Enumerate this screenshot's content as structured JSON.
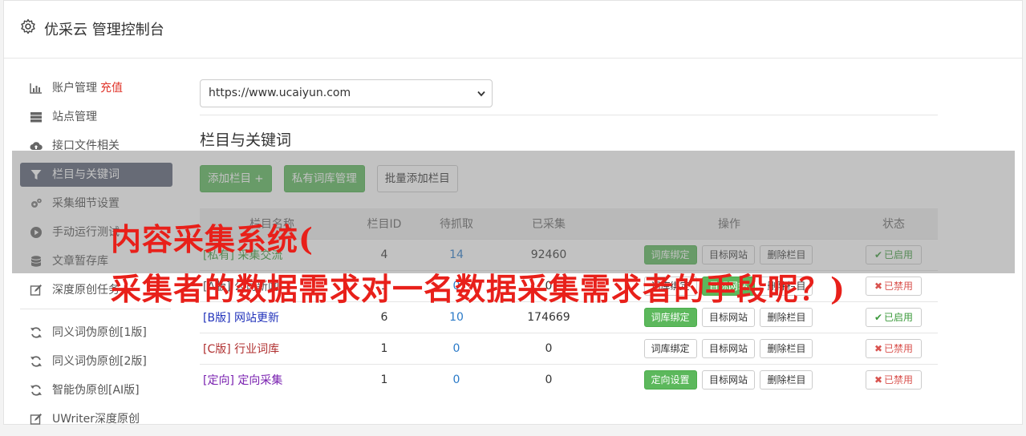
{
  "header": {
    "title": "优采云 管理控制台",
    "icon": "gear-icon"
  },
  "sidebar": {
    "items": [
      {
        "label": "账户管理",
        "extra": "充值",
        "icon": "bar-chart-icon"
      },
      {
        "label": "站点管理",
        "icon": "server-icon"
      },
      {
        "label": "接口文件相关",
        "icon": "cloud-upload-icon"
      },
      {
        "label": "栏目与关键词",
        "icon": "filter-icon",
        "active": true
      },
      {
        "label": "采集细节设置",
        "icon": "cogs-icon"
      },
      {
        "label": "手动运行测试",
        "icon": "play-circle-icon"
      },
      {
        "label": "文章暂存库",
        "icon": "database-icon"
      },
      {
        "label": "深度原创任务",
        "icon": "edit-icon"
      }
    ],
    "items2": [
      {
        "label": "同义词伪原创[1版]",
        "icon": "refresh-icon"
      },
      {
        "label": "同义词伪原创[2版]",
        "icon": "refresh-icon"
      },
      {
        "label": "智能伪原创[AI版]",
        "icon": "refresh-icon"
      },
      {
        "label": "UWriter深度原创",
        "icon": "edit-icon"
      }
    ]
  },
  "main": {
    "site_select": "https://www.ucaiyun.com",
    "section_title": "栏目与关键词",
    "buttons": {
      "add_column": "添加栏目 +",
      "private_lexicon": "私有词库管理",
      "batch_add": "批量添加栏目"
    },
    "table": {
      "headers": [
        "栏目名称",
        "栏目ID",
        "待抓取",
        "已采集",
        "操作",
        "状态"
      ],
      "rows": [
        {
          "name": "[私有] 采集交流",
          "id": "4",
          "pending": "14",
          "collected": "92460",
          "op1": "词库绑定",
          "op2": "目标网站",
          "op3": "删除栏目",
          "status": "已启用"
        },
        {
          "name": "[A版] 公司新闻",
          "id": "1",
          "pending": "0",
          "collected": "0",
          "op1": "词库绑定",
          "op2": "目标网站",
          "op3": "删除栏目",
          "status": "已禁用"
        },
        {
          "name": "[B版] 网站更新",
          "id": "6",
          "pending": "10",
          "collected": "174669",
          "op1": "词库绑定",
          "op2": "目标网站",
          "op3": "删除栏目",
          "status": "已启用"
        },
        {
          "name": "[C版] 行业词库",
          "id": "1",
          "pending": "0",
          "collected": "0",
          "op1": "词库绑定",
          "op2": "目标网站",
          "op3": "删除栏目",
          "status": "已禁用"
        },
        {
          "name": "[定向] 定向采集",
          "id": "1",
          "pending": "0",
          "collected": "0",
          "op1": "定向设置",
          "op2": "目标网站",
          "op3": "删除栏目",
          "status": "已禁用"
        }
      ]
    }
  },
  "overlay": {
    "line1": "内容采集系统(",
    "line2": "采集者的数据需求对一名数据采集需求者的手段呢？)"
  },
  "colors": {
    "green": "#5cb85c",
    "active_nav": "#5a6275",
    "overlay_text": "#e8201a"
  }
}
